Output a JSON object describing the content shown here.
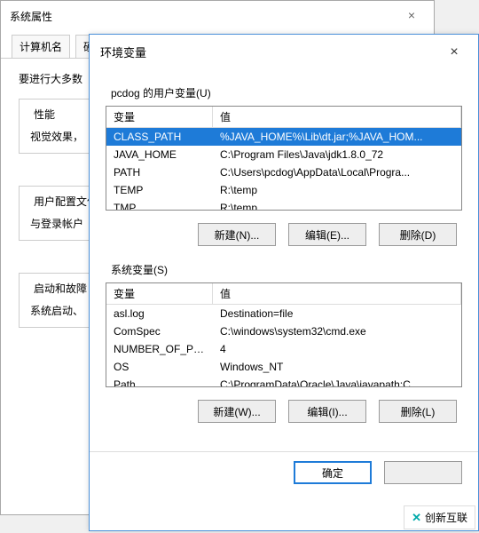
{
  "back": {
    "title": "系统属性",
    "tabs": [
      "计算机名",
      "硬件"
    ],
    "message": "要进行大多数",
    "groups": [
      {
        "title": "性能",
        "line1": "视觉效果，"
      },
      {
        "title": "用户配置文件",
        "line1": "与登录帐户"
      },
      {
        "title": "启动和故障",
        "line1": "系统启动、"
      }
    ]
  },
  "front": {
    "title": "环境变量",
    "userLabel": "pcdog 的用户变量(U)",
    "header": {
      "name": "变量",
      "value": "值"
    },
    "userVars": [
      {
        "name": "CLASS_PATH",
        "value": "%JAVA_HOME%\\Lib\\dt.jar;%JAVA_HOM...",
        "selected": true
      },
      {
        "name": "JAVA_HOME",
        "value": "C:\\Program Files\\Java\\jdk1.8.0_72"
      },
      {
        "name": "PATH",
        "value": "C:\\Users\\pcdog\\AppData\\Local\\Progra..."
      },
      {
        "name": "TEMP",
        "value": "R:\\temp"
      },
      {
        "name": "TMP",
        "value": "R:\\temp"
      }
    ],
    "userButtons": {
      "new": "新建(N)...",
      "edit": "编辑(E)...",
      "del": "删除(D)"
    },
    "sysLabel": "系统变量(S)",
    "sysVars": [
      {
        "name": "asl.log",
        "value": "Destination=file"
      },
      {
        "name": "ComSpec",
        "value": "C:\\windows\\system32\\cmd.exe"
      },
      {
        "name": "NUMBER_OF_PR...",
        "value": "4"
      },
      {
        "name": "OS",
        "value": "Windows_NT"
      },
      {
        "name": "Path",
        "value": "C:\\ProgramData\\Oracle\\Java\\javapath;C"
      }
    ],
    "sysButtons": {
      "new": "新建(W)...",
      "edit": "编辑(I)...",
      "del": "删除(L)"
    },
    "footer": {
      "ok": "确定",
      "cancel": ""
    }
  },
  "watermark": {
    "text": "创新互联"
  }
}
